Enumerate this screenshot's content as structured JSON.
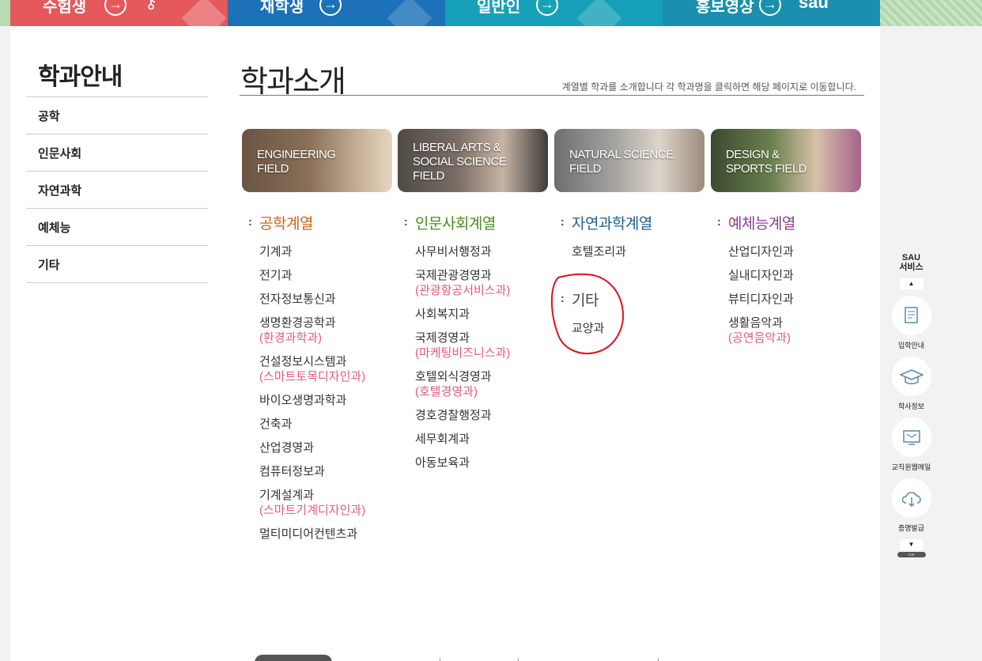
{
  "top_tabs": [
    {
      "label": "수험생"
    },
    {
      "label": "재학생"
    },
    {
      "label": "일반인"
    },
    {
      "label": "홍보영상"
    }
  ],
  "top_tabs_extra": {
    "logo_text": "sau"
  },
  "sidebar": {
    "title": "학과안내",
    "items": [
      {
        "label": "공학"
      },
      {
        "label": "인문사회"
      },
      {
        "label": "자연과학"
      },
      {
        "label": "예체능"
      },
      {
        "label": "기타"
      }
    ]
  },
  "main": {
    "title": "학과소개",
    "description": "계열별 학과를 소개합니다 각 학과명을 클릭하면 해당 페이지로 이동합니다."
  },
  "cards": [
    {
      "lines": [
        "ENGINEERING",
        "FIELD"
      ]
    },
    {
      "lines": [
        "LIBERAL ARTS &",
        "SOCIAL SCIENCE",
        "FIELD"
      ]
    },
    {
      "lines": [
        "NATURAL SCIENCE",
        "FIELD"
      ]
    },
    {
      "lines": [
        "DESIGN &",
        "SPORTS FIELD"
      ]
    }
  ],
  "columns": {
    "engineering": {
      "heading": "공학계열",
      "items": [
        {
          "name": "기계과",
          "sub": ""
        },
        {
          "name": "전기과",
          "sub": ""
        },
        {
          "name": "전자정보통신과",
          "sub": ""
        },
        {
          "name": "생명환경공학과",
          "sub": "(환경과학과)"
        },
        {
          "name": "건설정보시스템과",
          "sub": "(스마트토목디자인과)"
        },
        {
          "name": "바이오생명과학과",
          "sub": ""
        },
        {
          "name": "건축과",
          "sub": ""
        },
        {
          "name": "산업경영과",
          "sub": ""
        },
        {
          "name": "컴퓨터정보과",
          "sub": ""
        },
        {
          "name": "기계설계과",
          "sub": "(스마트기계디자인과)"
        },
        {
          "name": "멀티미디어컨텐츠과",
          "sub": ""
        }
      ]
    },
    "humanities": {
      "heading": "인문사회계열",
      "items": [
        {
          "name": "사무비서행정과",
          "sub": ""
        },
        {
          "name": "국제관광경영과",
          "sub": "(관광항공서비스과)"
        },
        {
          "name": "사회복지과",
          "sub": ""
        },
        {
          "name": "국제경영과",
          "sub": "(마케팅비즈니스과)"
        },
        {
          "name": "호텔외식경영과",
          "sub": "(호텔경영과)"
        },
        {
          "name": "경호경찰행정과",
          "sub": ""
        },
        {
          "name": "세무회계과",
          "sub": ""
        },
        {
          "name": "아동보육과",
          "sub": ""
        }
      ]
    },
    "natural": {
      "heading": "자연과학계열",
      "items": [
        {
          "name": "호텔조리과",
          "sub": ""
        }
      ]
    },
    "etc": {
      "heading": "기타",
      "items": [
        {
          "name": "교양과",
          "sub": ""
        }
      ]
    },
    "arts": {
      "heading": "예체능계열",
      "items": [
        {
          "name": "산업디자인과",
          "sub": ""
        },
        {
          "name": "실내디자인과",
          "sub": ""
        },
        {
          "name": "뷰티디자인과",
          "sub": ""
        },
        {
          "name": "생활음악과",
          "sub": "(공연음악과)"
        }
      ]
    }
  },
  "quick_services": {
    "title_line1": "SAU",
    "title_line2": "서비스",
    "up_symbol": "▲",
    "down_symbol": "▼",
    "top_label": "TOP",
    "items": [
      {
        "label": "입학안내",
        "icon": "document-icon"
      },
      {
        "label": "학사정보",
        "icon": "graduation-cap-icon"
      },
      {
        "label": "교직원웹메일",
        "icon": "mail-monitor-icon"
      },
      {
        "label": "증명발급",
        "icon": "cloud-download-icon"
      }
    ]
  },
  "colors": {
    "tab1": "#e5585c",
    "tab2": "#1c71b8",
    "tab3": "#17a1b8",
    "tab4": "#1a8fae",
    "engineering": "#d0621a",
    "humanities": "#4c8a1d",
    "natural": "#1f5f91",
    "arts": "#8a3d8f",
    "sub_label": "#e85a7a",
    "annotation": "#e0121a"
  }
}
